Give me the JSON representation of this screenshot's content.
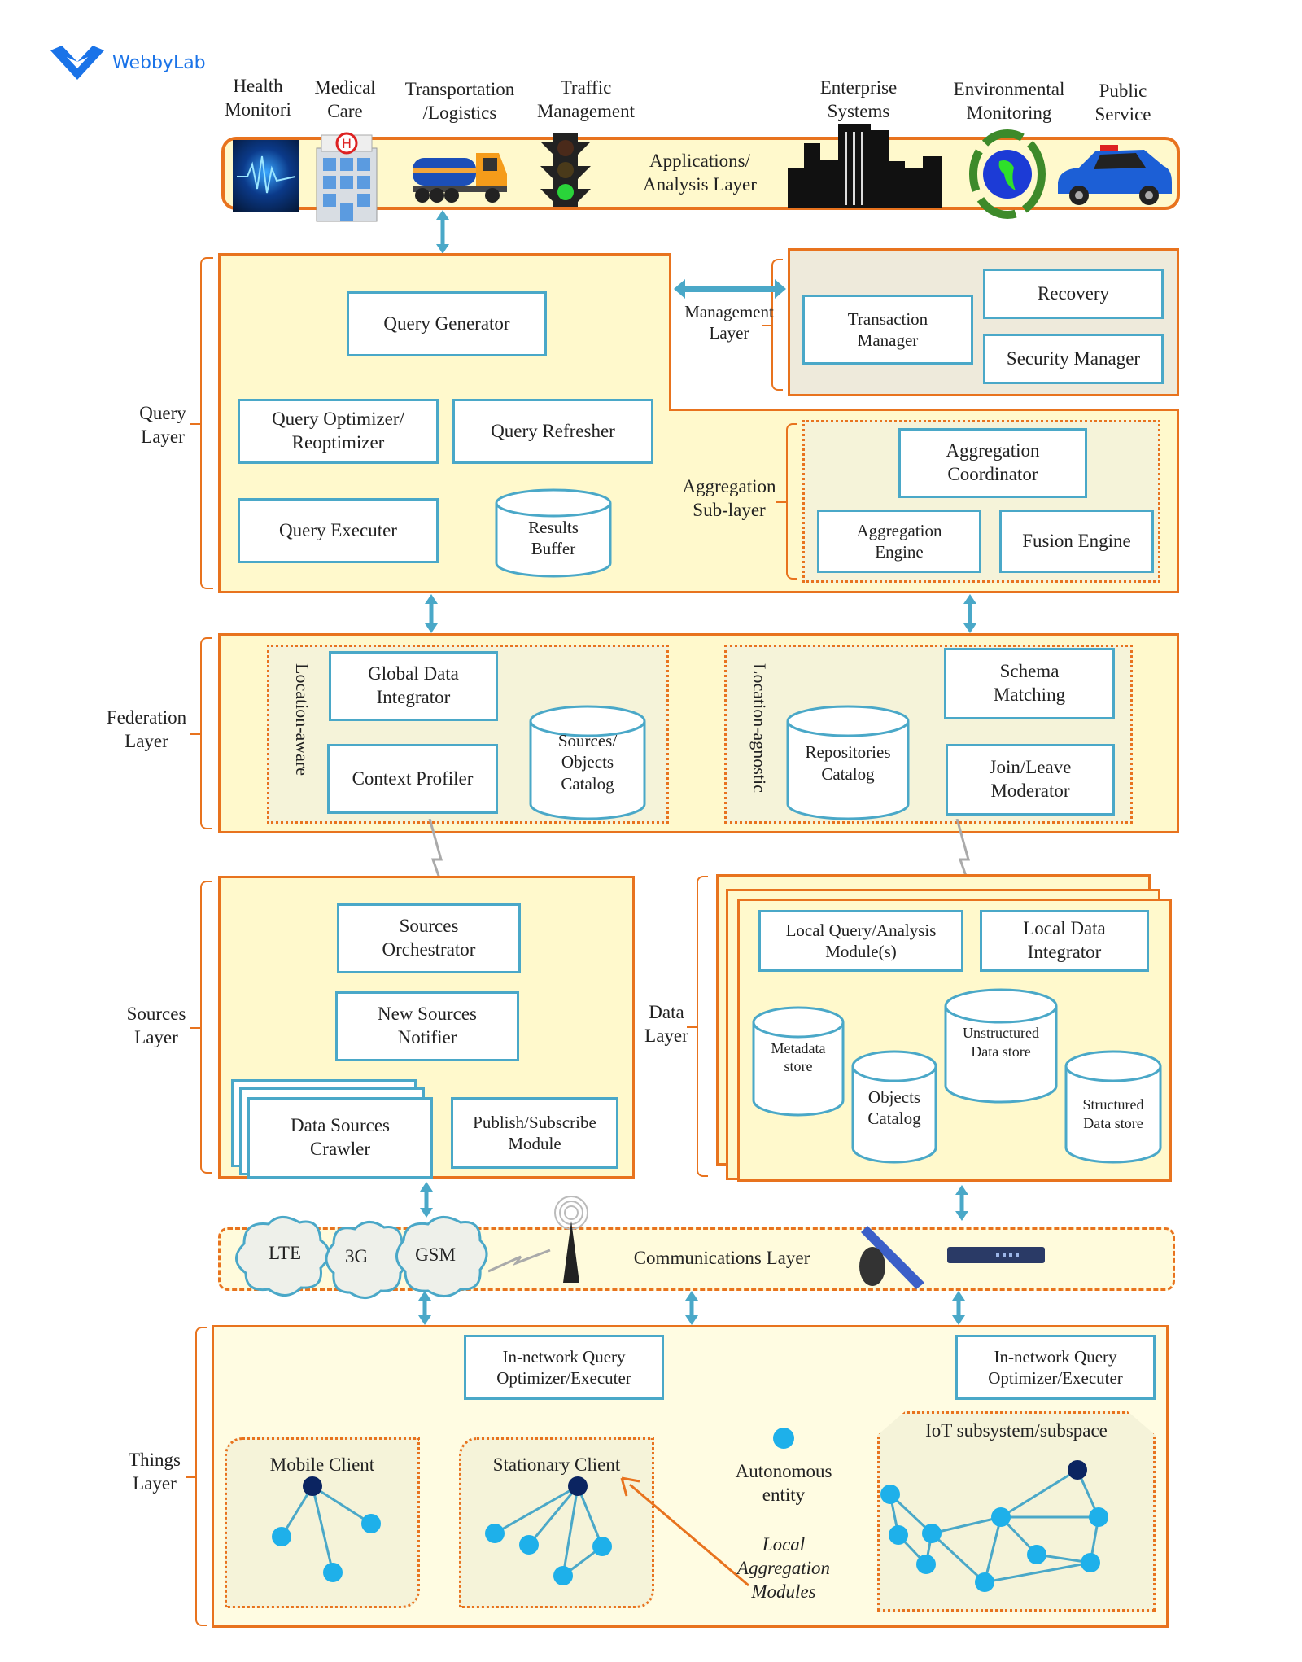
{
  "brand": {
    "name": "WebbyLab",
    "color": "#1a73e8"
  },
  "colors": {
    "layer_border": "#e8731e",
    "layer_fill": "#fff9cc",
    "box_border": "#4aa8c8",
    "arrow": "#4aa8c8",
    "node_light": "#1eb0ea",
    "node_dark": "#0b2461"
  },
  "applications": {
    "layer_label": "Applications/\nAnalysis Layer",
    "categories": [
      {
        "label": "Health\nMonitori",
        "icon": "brain-wave-icon"
      },
      {
        "label": "Medical\nCare",
        "icon": "hospital-icon"
      },
      {
        "label": "Transportation\n/Logistics",
        "icon": "tanker-truck-icon"
      },
      {
        "label": "Traffic\nManagement",
        "icon": "traffic-light-icon"
      },
      {
        "label": "Enterprise\nSystems",
        "icon": "city-skyline-icon"
      },
      {
        "label": "Environmental\nMonitoring",
        "icon": "recycle-globe-icon"
      },
      {
        "label": "Public\nService",
        "icon": "police-car-icon"
      }
    ]
  },
  "query_layer": {
    "label": "Query\nLayer",
    "query_generator": "Query Generator",
    "query_optimizer": "Query Optimizer/\nReoptimizer",
    "query_refresher": "Query Refresher",
    "query_executer": "Query Executer",
    "results_buffer": "Results\nBuffer"
  },
  "management_layer": {
    "label": "Management\nLayer",
    "transaction_manager": "Transaction\nManager",
    "recovery": "Recovery",
    "security_manager": "Security Manager"
  },
  "aggregation_sublayer": {
    "label": "Aggregation\nSub-layer",
    "coordinator": "Aggregation\nCoordinator",
    "engine": "Aggregation\nEngine",
    "fusion_engine": "Fusion Engine"
  },
  "federation_layer": {
    "label": "Federation\nLayer",
    "location_aware": "Location-aware",
    "global_data_integrator": "Global Data\nIntegrator",
    "context_profiler": "Context Profiler",
    "sources_objects_catalog": "Sources/\nObjects\nCatalog",
    "location_agnostic": "Location-agnostic",
    "repositories_catalog": "Repositories\nCatalog",
    "schema_matching": "Schema\nMatching",
    "join_leave_moderator": "Join/Leave\nModerator"
  },
  "sources_layer": {
    "label": "Sources\nLayer",
    "orchestrator": "Sources\nOrchestrator",
    "new_sources_notifier": "New Sources\nNotifier",
    "crawler": "Data Sources\nCrawler",
    "publish_subscribe": "Publish/Subscribe\nModule"
  },
  "data_layer": {
    "label": "Data\nLayer",
    "local_query": "Local Query/Analysis\nModule(s)",
    "local_integrator": "Local Data\nIntegrator",
    "metadata_store": "Metadata\nstore",
    "objects_catalog": "Objects\nCatalog",
    "unstructured_store": "Unstructured\nData store",
    "structured_store": "Structured\nData store"
  },
  "communications_layer": {
    "label": "Communications Layer",
    "clouds": [
      "LTE",
      "3G",
      "GSM"
    ]
  },
  "things_layer": {
    "label": "Things\nLayer",
    "innetwork_1": "In-network Query\nOptimizer/Executer",
    "innetwork_2": "In-network Query\nOptimizer/Executer",
    "mobile_client": "Mobile Client",
    "stationary_client": "Stationary Client",
    "autonomous_entity": "Autonomous\nentity",
    "local_aggregation": "Local\nAggregation\nModules",
    "iot_subsystem": "IoT subsystem/subspace"
  }
}
